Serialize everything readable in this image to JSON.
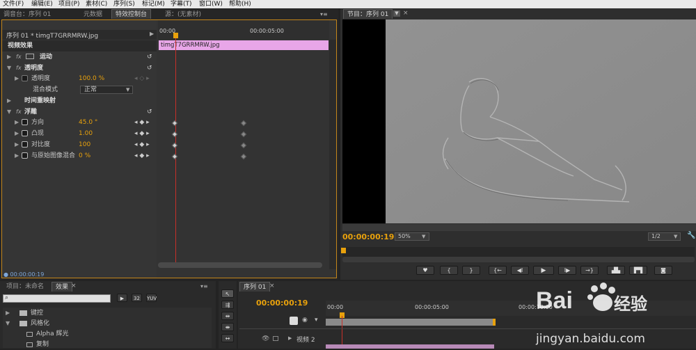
{
  "menu": [
    "文件(F)",
    "编辑(E)",
    "项目(P)",
    "素材(C)",
    "序列(S)",
    "标记(M)",
    "字幕(T)",
    "窗口(W)",
    "帮助(H)"
  ],
  "source_panel": {
    "tabs": [
      "调音台：序列 01",
      "元数据",
      "特效控制台",
      "源：(无素材)"
    ],
    "sequence_label": "序列 01 * timgT7GRRMRW.jpg",
    "header_time_start": "00:00",
    "header_time_mid": "00:00:05:00",
    "section": "视频效果",
    "clip_name": "timgT7GRRMRW.jpg",
    "effects": {
      "motion": "运动",
      "opacity": "透明度",
      "opacity_prop": "透明度",
      "opacity_val": "100.0 %",
      "blend_label": "混合模式",
      "blend_val": "正常",
      "time_remap": "时间重映射",
      "emboss": "浮雕",
      "direction": "方向",
      "direction_val": "45.0 °",
      "relief": "凸现",
      "relief_val": "1.00",
      "contrast": "对比度",
      "contrast_val": "100",
      "blend_orig": "与原始图像混合",
      "blend_orig_val": "0 %"
    },
    "footer_time": "00:00:00:19"
  },
  "program_panel": {
    "tab": "节目：序列 01",
    "timecode": "00:00:00:19",
    "zoom": "50%",
    "quality": "1/2",
    "controls": [
      "{",
      "}",
      "{←",
      "◀I",
      "▶",
      "I▶",
      "→}"
    ]
  },
  "project_panel": {
    "tabs": [
      "项目：未命名",
      "效果"
    ],
    "items": [
      {
        "label": "键控",
        "level": 1
      },
      {
        "label": "风格化",
        "level": 1
      },
      {
        "label": "Alpha 辉光",
        "level": 2
      },
      {
        "label": "复制",
        "level": 2
      }
    ]
  },
  "timeline": {
    "tab": "序列 01",
    "timecode": "00:00:00:19",
    "t0": "00:00",
    "t1": "00:00:05:00",
    "t2": "00:00:10:00",
    "track": "视频 2"
  },
  "watermark": {
    "brand": "Bai",
    "brand2": "经验",
    "url": "jingyan.baidu.com"
  }
}
